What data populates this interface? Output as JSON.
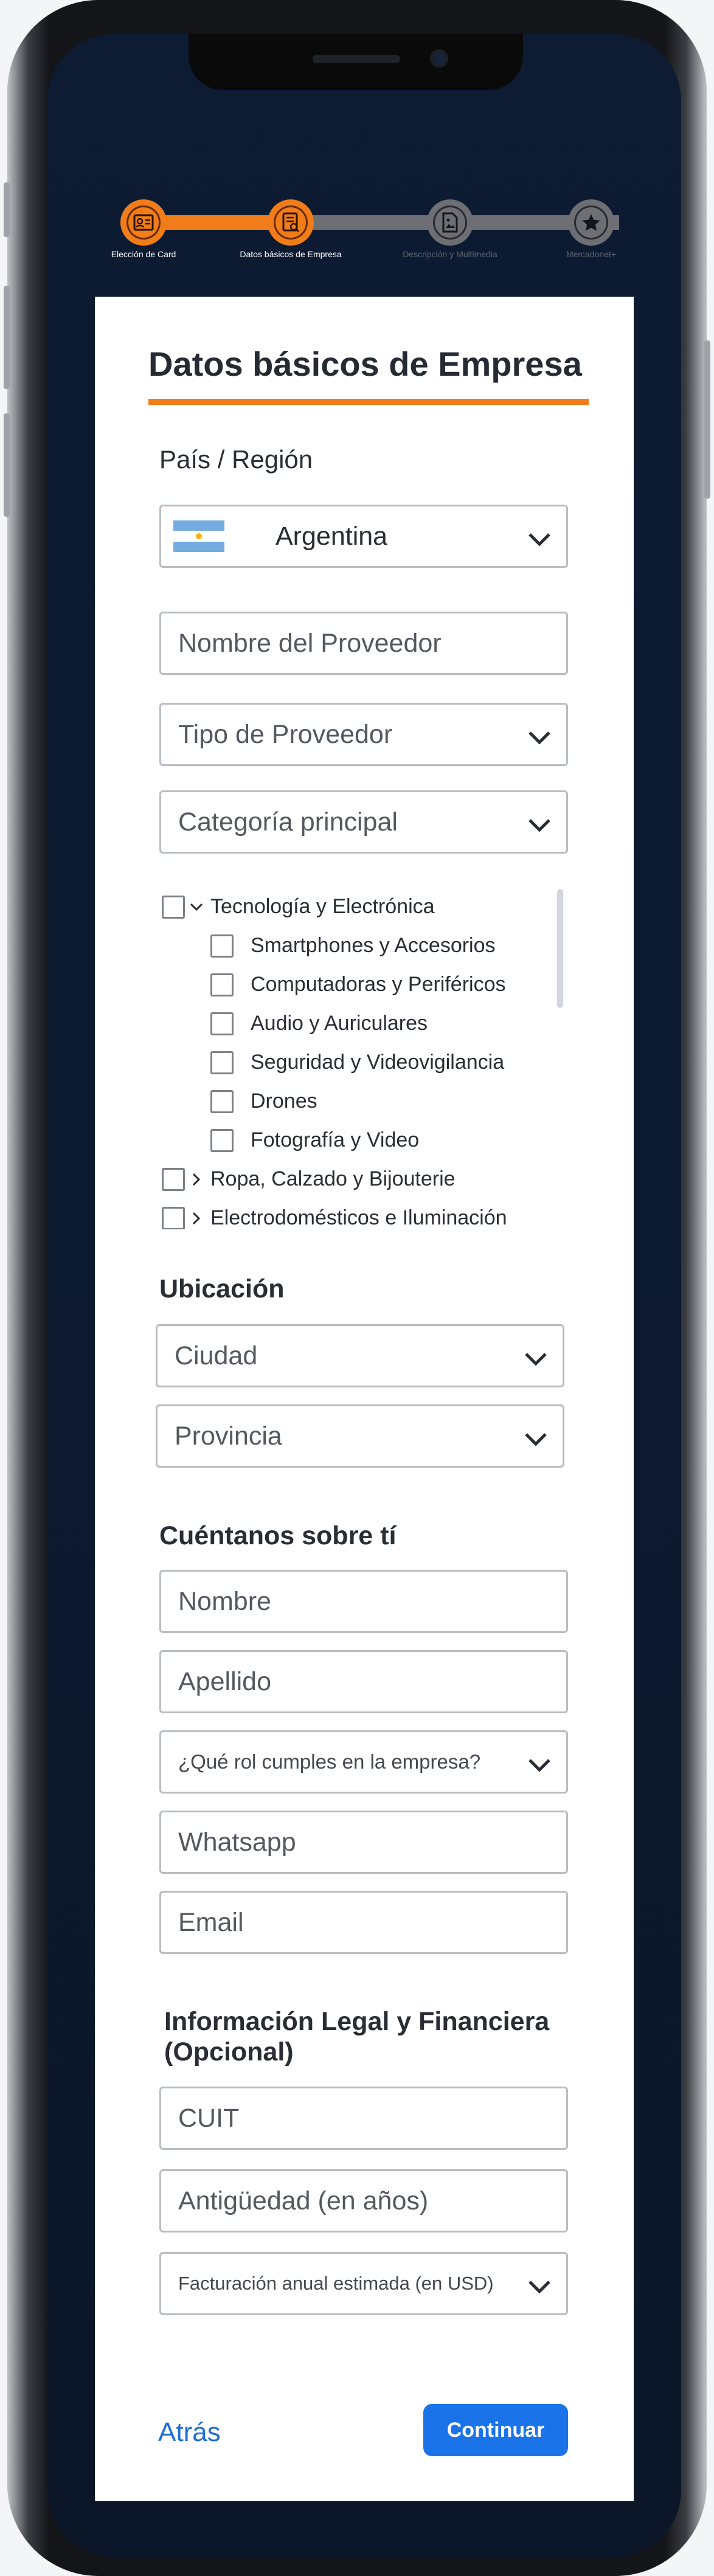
{
  "stepper": {
    "steps": [
      {
        "label": "Elección de Card",
        "state": "done",
        "icon": "id-card-icon"
      },
      {
        "label": "Datos básicos de Empresa",
        "state": "active",
        "icon": "document-icon"
      },
      {
        "label": "Descripción y Multimedia",
        "state": "pending",
        "icon": "file-image-icon"
      },
      {
        "label": "Mercadonet+",
        "state": "pending",
        "icon": "star-icon"
      }
    ]
  },
  "form": {
    "title": "Datos básicos de Empresa",
    "country_label": "País / Región",
    "country_value": "Argentina",
    "provider_name_placeholder": "Nombre del Proveedor",
    "provider_type_placeholder": "Tipo de Proveedor",
    "main_category_placeholder": "Categoría principal",
    "categories": [
      {
        "label": "Tecnología y Electrónica",
        "expanded": true,
        "children": [
          "Smartphones y Accesorios",
          "Computadoras y Periféricos",
          "Audio y Auriculares",
          "Seguridad y Videovigilancia",
          "Drones",
          "Fotografía y Video"
        ]
      },
      {
        "label": "Ropa, Calzado y Bijouterie",
        "expanded": false
      },
      {
        "label": "Electrodomésticos e Iluminación",
        "expanded": false
      }
    ],
    "location_heading": "Ubicación",
    "city_placeholder": "Ciudad",
    "province_placeholder": "Provincia",
    "about_heading": "Cuéntanos sobre tí",
    "first_name_placeholder": "Nombre",
    "last_name_placeholder": "Apellido",
    "role_placeholder": "¿Qué rol cumples en la empresa?",
    "whatsapp_placeholder": "Whatsapp",
    "email_placeholder": "Email",
    "legal_heading_line1": "Información Legal y Financiera",
    "legal_heading_line2": "(Opcional)",
    "cuit_placeholder": "CUIT",
    "seniority_placeholder": "Antigüedad (en años)",
    "revenue_placeholder": "Facturación anual estimada (en USD)",
    "back_label": "Atrás",
    "continue_label": "Continuar"
  },
  "colors": {
    "accent": "#f07d1a",
    "primary": "#1a73e8",
    "background": "#0d1b33"
  }
}
